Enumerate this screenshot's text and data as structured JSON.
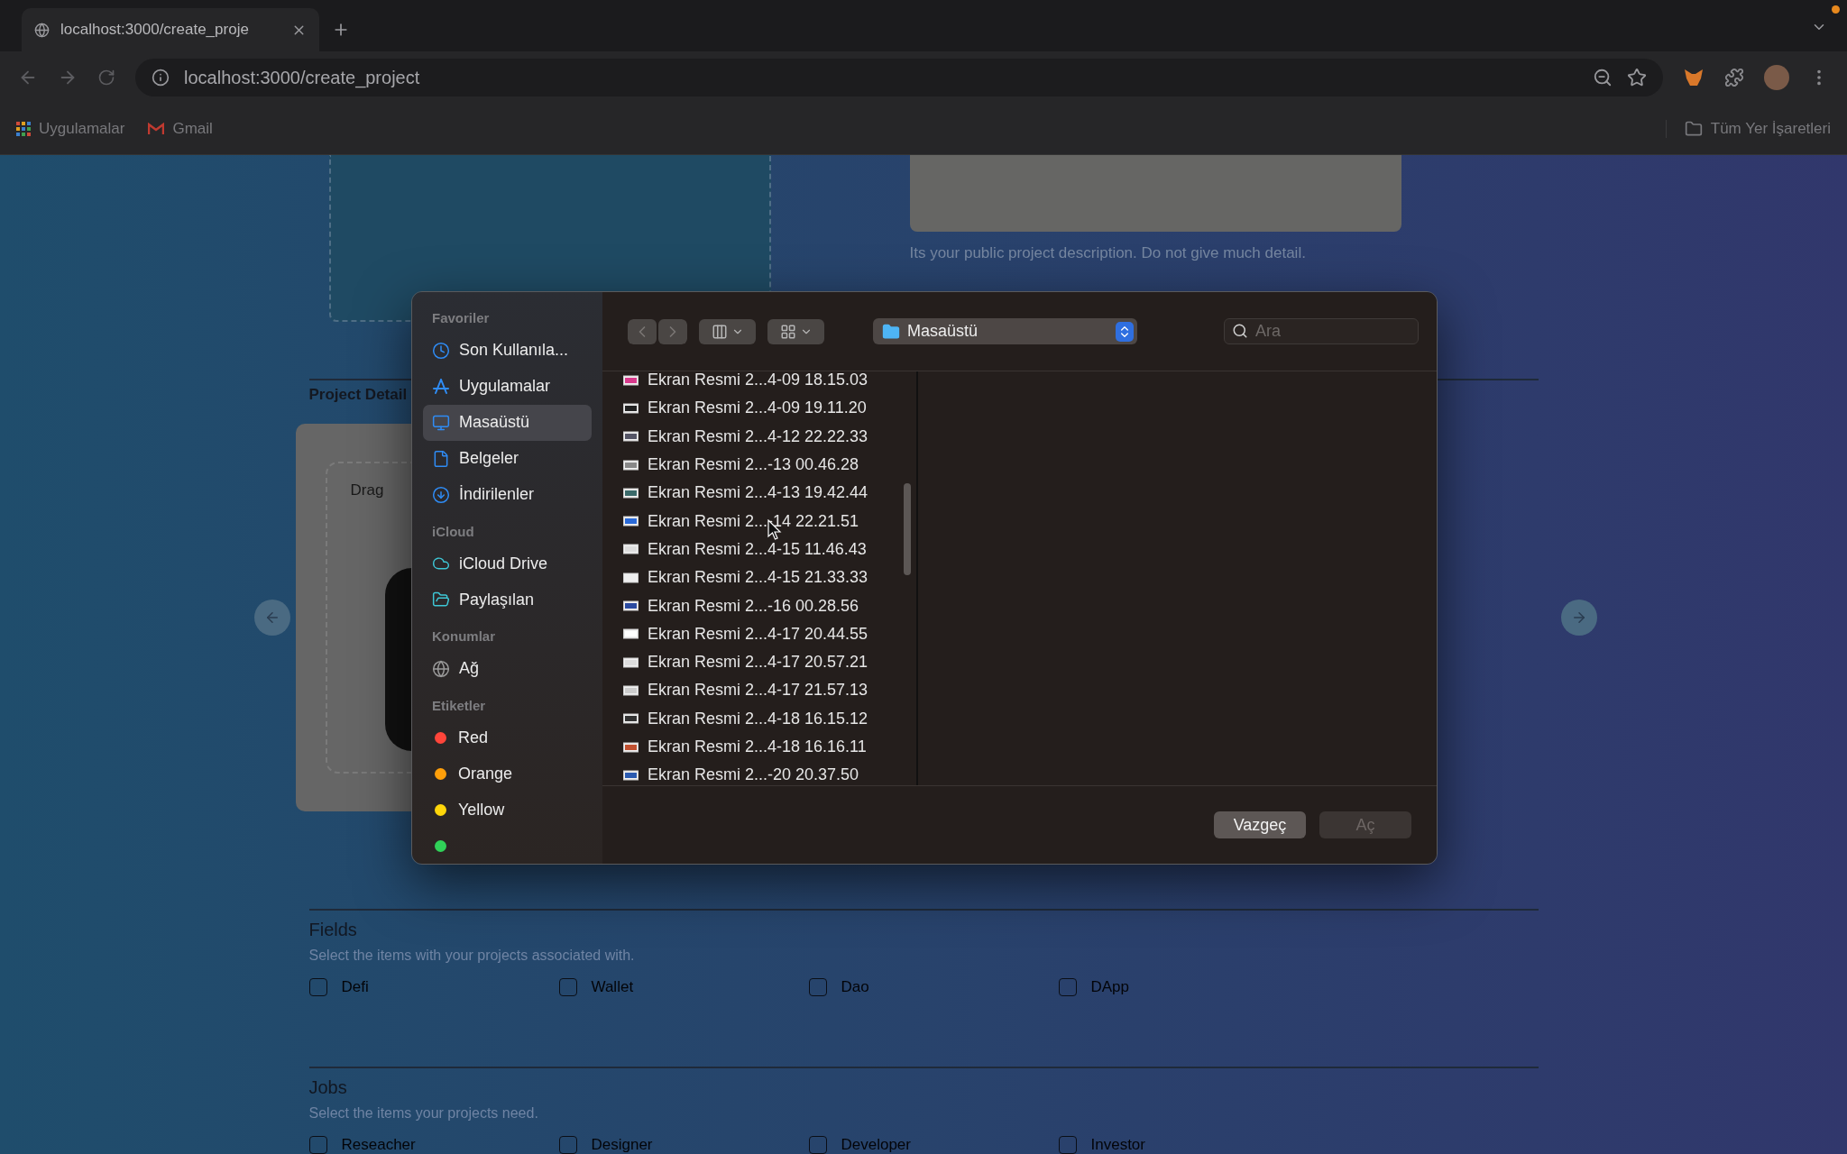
{
  "browser": {
    "tab_title": "localhost:3000/create_proje",
    "address": "localhost:3000/create_project",
    "bookmarks": [
      {
        "label": "Uygulamalar",
        "kind": "apps"
      },
      {
        "label": "Gmail",
        "kind": "mail"
      }
    ],
    "all_bookmarks": "Tüm Yer İşaretleri"
  },
  "page": {
    "description_hint": "Its your public project description. Do not give much detail.",
    "section_title": "Project Detail",
    "drop_text": "Drag",
    "groups": [
      {
        "title": "Fields",
        "subtitle": "Select the items with your projects associated with.",
        "options": [
          {
            "label": "Defi",
            "checked": false
          },
          {
            "label": "Wallet",
            "checked": false
          },
          {
            "label": "Dao",
            "checked": false
          },
          {
            "label": "DApp",
            "checked": false
          }
        ]
      },
      {
        "title": "Jobs",
        "subtitle": "Select the items your projects need.",
        "options": [
          {
            "label": "Reseacher",
            "checked": false
          },
          {
            "label": "Designer",
            "checked": false
          },
          {
            "label": "Developer",
            "checked": false
          },
          {
            "label": "Investor",
            "checked": false
          }
        ]
      }
    ]
  },
  "dialog": {
    "sidebar": [
      {
        "title": "Favoriler",
        "items": [
          {
            "label": "Son Kullanıla...",
            "kind": "recent",
            "selected": false
          },
          {
            "label": "Uygulamalar",
            "kind": "apps",
            "selected": false
          },
          {
            "label": "Masaüstü",
            "kind": "desktop",
            "selected": true
          },
          {
            "label": "Belgeler",
            "kind": "documents",
            "selected": false
          },
          {
            "label": "İndirilenler",
            "kind": "downloads",
            "selected": false
          }
        ]
      },
      {
        "title": "iCloud",
        "items": [
          {
            "label": "iCloud Drive",
            "kind": "cloud",
            "selected": false
          },
          {
            "label": "Paylaşılan",
            "kind": "shared",
            "selected": false
          }
        ]
      },
      {
        "title": "Konumlar",
        "items": [
          {
            "label": "Ağ",
            "kind": "network",
            "selected": false
          }
        ]
      }
    ],
    "tags_title": "Etiketler",
    "tags": [
      {
        "label": "Red",
        "color": "#ff453a"
      },
      {
        "label": "Orange",
        "color": "#ff9f0a"
      },
      {
        "label": "Yellow",
        "color": "#ffd60a"
      },
      {
        "color": "#30d158"
      }
    ],
    "location": "Masaüstü",
    "search_placeholder": "Ara",
    "files": [
      "Ekran Resmi 2...4-09 18.15.03",
      "Ekran Resmi 2...4-09 19.11.20",
      "Ekran Resmi 2...4-12 22.22.33",
      "Ekran Resmi 2...-13 00.46.28",
      "Ekran Resmi 2...4-13 19.42.44",
      "Ekran Resmi 2...-14 22.21.51",
      "Ekran Resmi 2...4-15 11.46.43",
      "Ekran Resmi 2...4-15 21.33.33",
      "Ekran Resmi 2...-16 00.28.56",
      "Ekran Resmi 2...4-17 20.44.55",
      "Ekran Resmi 2...4-17 20.57.21",
      "Ekran Resmi 2...4-17 21.57.13",
      "Ekran Resmi 2...4-18 16.15.12",
      "Ekran Resmi 2...4-18 16.16.11",
      "Ekran Resmi 2...-20 20.37.50"
    ],
    "cancel": "Vazgeç",
    "open": {
      "label": "Aç",
      "disabled": true
    }
  }
}
